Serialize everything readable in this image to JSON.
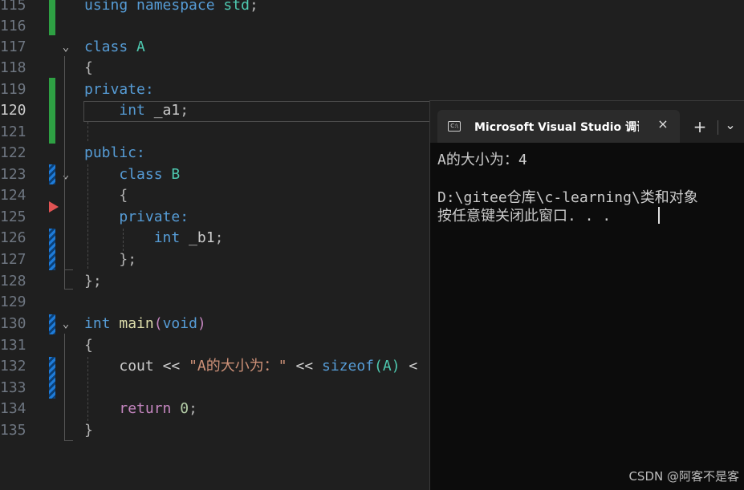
{
  "editor": {
    "line_numbers": [
      "115",
      "116",
      "117",
      "118",
      "119",
      "120",
      "121",
      "122",
      "123",
      "124",
      "125",
      "126",
      "127",
      "128",
      "129",
      "130",
      "131",
      "132",
      "133",
      "134",
      "135"
    ],
    "active_line": "120",
    "tokens": {
      "using": "using",
      "namespace": "namespace",
      "std": "std",
      "semicolon": ";",
      "class": "class",
      "A": "A",
      "brace_open": "{",
      "brace_close": "}",
      "brace_close_semi": "};",
      "private_colon": "private:",
      "public_colon": "public:",
      "int": "int",
      "a1": "_a1",
      "B": "B",
      "b1": "_b1",
      "main": "main",
      "paren_open": "(",
      "void": "void",
      "paren_close": ")",
      "cout": "cout",
      "shl": "<<",
      "str_a": "\"A的大小为：\"",
      "sizeof": "sizeof",
      "arg_A": "(A)",
      "shl_partial": "<",
      "return": "return",
      "zero": "0"
    }
  },
  "console": {
    "tab_title": "Microsoft Visual Studio 调试控",
    "tab_icon_text": "C:\\",
    "close_icon": "×",
    "new_tab_icon": "+",
    "dropdown_icon": "⌄",
    "output_line_1": "A的大小为：4",
    "output_line_2": "D:\\gitee仓库\\c-learning\\类和对象",
    "output_line_3": "按任意键关闭此窗口. . ."
  },
  "watermark": "CSDN @阿客不是客",
  "colors": {
    "keyword": "#569cd6",
    "type": "#4ec9b0",
    "function": "#dcdcaa",
    "string": "#ce9178",
    "control": "#c586c0",
    "change_green": "#2ea043",
    "change_blue": "#1e7bd8"
  }
}
